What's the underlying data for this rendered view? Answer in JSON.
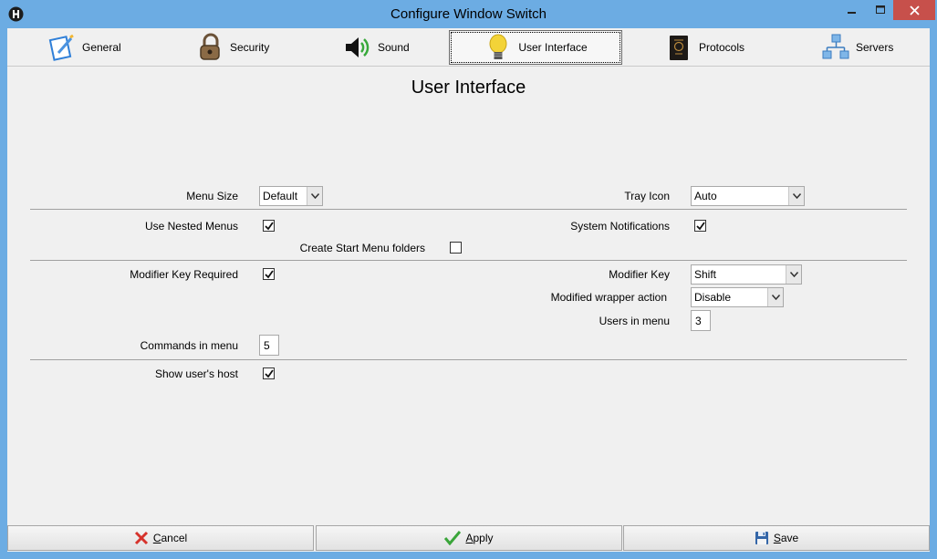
{
  "window": {
    "title": "Configure Window Switch"
  },
  "tabs": [
    {
      "label": "General",
      "icon": "general-icon"
    },
    {
      "label": "Security",
      "icon": "padlock-icon"
    },
    {
      "label": "Sound",
      "icon": "speaker-icon"
    },
    {
      "label": "User Interface",
      "icon": "lightbulb-icon",
      "active": true
    },
    {
      "label": "Protocols",
      "icon": "passport-icon"
    },
    {
      "label": "Servers",
      "icon": "servers-icon"
    }
  ],
  "section": {
    "title": "User Interface"
  },
  "settings": {
    "menu_size_label": "Menu Size",
    "menu_size_value": "Default",
    "tray_icon_label": "Tray Icon",
    "tray_icon_value": "Auto",
    "use_nested_menus_label": "Use Nested Menus",
    "use_nested_menus_checked": true,
    "system_notifications_label": "System Notifications",
    "system_notifications_checked": true,
    "create_start_menu_label": "Create Start Menu folders",
    "create_start_menu_checked": false,
    "modifier_key_required_label": "Modifier Key Required",
    "modifier_key_required_checked": true,
    "modifier_key_label": "Modifier Key",
    "modifier_key_value": "Shift",
    "modified_wrapper_label": "Modified wrapper action",
    "modified_wrapper_value": "Disable",
    "users_in_menu_label": "Users in menu",
    "users_in_menu_value": "3",
    "commands_in_menu_label": "Commands in menu",
    "commands_in_menu_value": "5",
    "show_users_host_label": "Show user's host",
    "show_users_host_checked": true
  },
  "buttons": {
    "cancel_first": "C",
    "cancel_rest": "ancel",
    "apply_first": "A",
    "apply_rest": "pply",
    "save_first": "S",
    "save_rest": "ave"
  },
  "colors": {
    "titlebar": "#6cace3",
    "close_button": "#c7504b",
    "client_bg": "#f0f0f0"
  }
}
